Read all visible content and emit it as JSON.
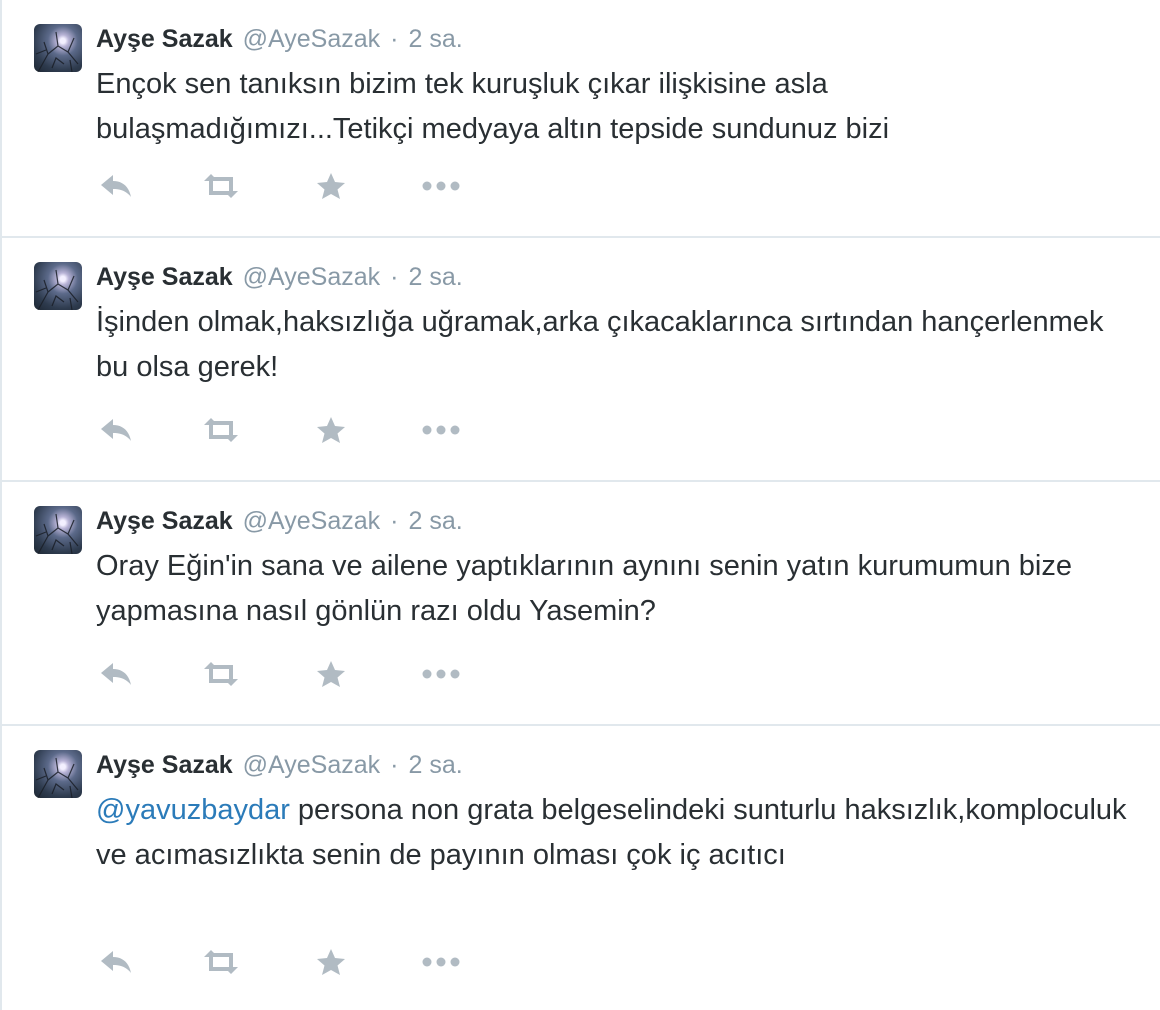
{
  "colors": {
    "text": "#292f33",
    "muted": "#8899a6",
    "link": "#2b7bb9",
    "action_icon": "#b1bbc3",
    "divider": "#e1e8ed"
  },
  "icons": {
    "reply": "reply-icon",
    "retweet": "retweet-icon",
    "favorite": "star-icon",
    "more": "more-dots-icon"
  },
  "tweets": [
    {
      "fullname": "Ayşe Sazak",
      "username": "@AyeSazak",
      "separator": "·",
      "time": "2 sa.",
      "mention": "",
      "text": "Ençok sen tanıksın bizim tek kuruşluk çıkar ilişkisine asla bulaşmadığımızı...Tetikçi medyaya altın tepside sundunuz bizi"
    },
    {
      "fullname": "Ayşe Sazak",
      "username": "@AyeSazak",
      "separator": "·",
      "time": "2 sa.",
      "mention": "",
      "text": "İşinden olmak,haksızlığa uğramak,arka çıkacaklarınca sırtından hançerlenmek bu olsa gerek!"
    },
    {
      "fullname": "Ayşe Sazak",
      "username": "@AyeSazak",
      "separator": "·",
      "time": "2 sa.",
      "mention": "",
      "text": "Oray Eğin'in sana ve ailene yaptıklarının aynını senin yatın kurumumun bize yapmasına nasıl gönlün razı oldu Yasemin?"
    },
    {
      "fullname": "Ayşe Sazak",
      "username": "@AyeSazak",
      "separator": "·",
      "time": "2 sa.",
      "mention": "@yavuzbaydar",
      "text": " persona non grata belgeselindeki sunturlu haksızlık,komploculuk ve acımasızlıkta senin de payının olması çok iç acıtıcı"
    }
  ]
}
